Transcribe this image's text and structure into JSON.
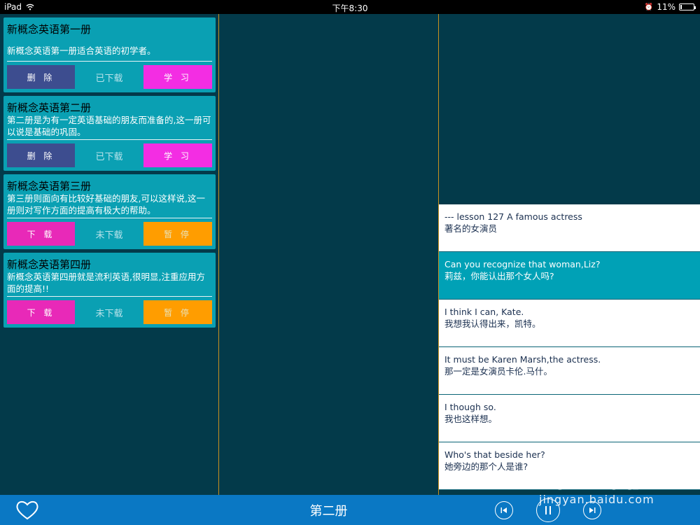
{
  "status_bar": {
    "device": "iPad",
    "time": "下午8:30",
    "battery_percent": "11%",
    "battery_level": 0.11
  },
  "books": [
    {
      "title": "新概念英语第一册",
      "description": "新概念英语第一册适合英语的初学者。",
      "left_button": "删 除",
      "state": "已下载",
      "right_button": "学 习"
    },
    {
      "title": "新概念英语第二册",
      "description": "第二册是为有一定英语基础的朋友而准备的,这一册可以说是基础的巩固。",
      "left_button": "删 除",
      "state": "已下载",
      "right_button": "学 习"
    },
    {
      "title": "新概念英语第三册",
      "description": "第三册则面向有比较好基础的朋友,可以这样说,这一册则对写作方面的提高有极大的帮助。",
      "left_button": "下 载",
      "state": "未下载",
      "right_button": "暂 停"
    },
    {
      "title": "新概念英语第四册",
      "description": "新概念英语第四册就是流利英语,很明显,注重应用方面的提高!!",
      "left_button": "下 载",
      "state": "未下载",
      "right_button": "暂 停"
    }
  ],
  "lessons": [
    {
      "en": "--- lesson 127  A famous actress",
      "zh": "著名的女演员"
    },
    {
      "en": "Can you recognize that woman,Liz?",
      "zh": "莉兹，你能认出那个女人吗?"
    },
    {
      "en": "I think I can, Kate.",
      "zh": "我想我认得出来，凯特。"
    },
    {
      "en": "It must be Karen Marsh,the actress.",
      "zh": "那一定是女演员卡伦.马什。"
    },
    {
      "en": "I though so.",
      "zh": "我也这样想。"
    },
    {
      "en": "Who's that beside her?",
      "zh": "她旁边的那个人是谁?"
    }
  ],
  "bottom_bar": {
    "title": "第二册",
    "favorite_icon": "heart-icon",
    "prev_icon": "skip-previous-icon",
    "play_icon": "pause-icon",
    "next_icon": "skip-next-icon"
  },
  "watermark": {
    "brand": "Baidu经验",
    "url": "jingyan.baidu.com"
  },
  "colors": {
    "background": "#033a4a",
    "card": "#0aa0b3",
    "delete_button": "#3d4d8f",
    "download_button": "#e829b8",
    "study_button": "#f32de3",
    "pause_button": "#ff9d00",
    "bottom_bar": "#0a78c4",
    "divider": "#c8901f"
  }
}
